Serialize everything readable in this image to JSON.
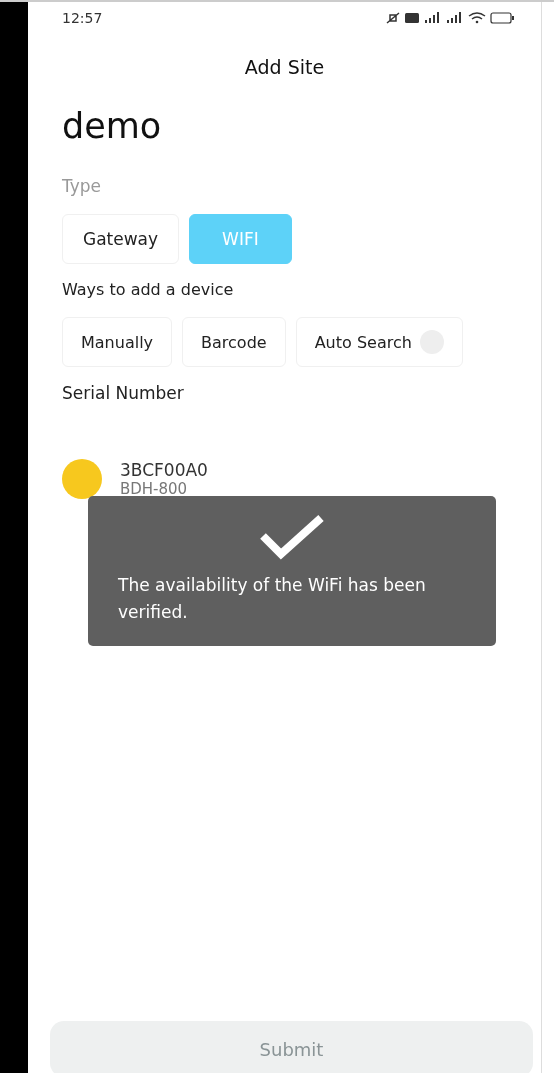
{
  "status_bar": {
    "time": "12:57"
  },
  "header": {
    "title": "Add Site"
  },
  "site_name": "demo",
  "type": {
    "label": "Type",
    "options": [
      {
        "label": "Gateway",
        "selected": false
      },
      {
        "label": "WIFI",
        "selected": true
      }
    ]
  },
  "ways": {
    "label": "Ways to add a device",
    "options": [
      {
        "label": "Manually",
        "kind": "plain"
      },
      {
        "label": "Barcode",
        "kind": "plain"
      },
      {
        "label": "Auto Search",
        "kind": "info"
      }
    ]
  },
  "serial": {
    "label": "Serial Number",
    "devices": [
      {
        "serial": "3BCF00A0",
        "model": "BDH-800",
        "color": "#f7c81e"
      }
    ]
  },
  "toast": {
    "message": "The availability of the WiFi has been verified."
  },
  "submit": {
    "label": "Submit",
    "disabled": true
  }
}
